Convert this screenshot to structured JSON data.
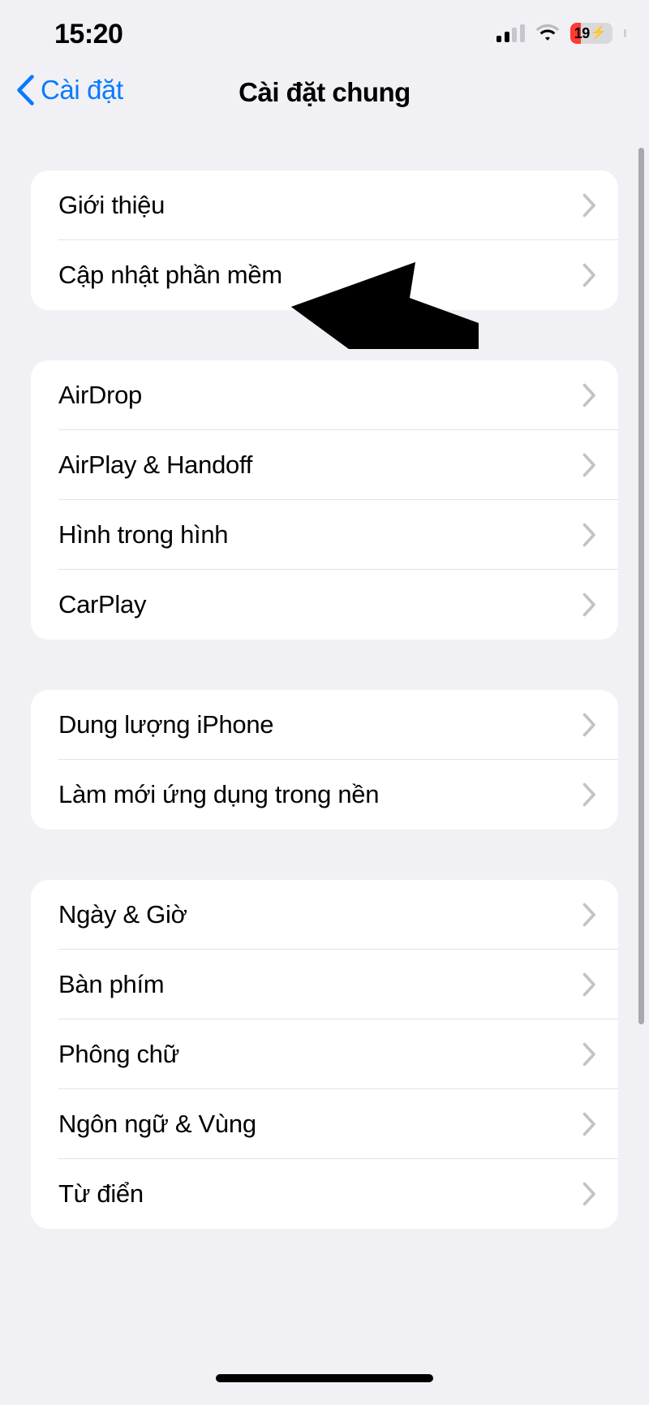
{
  "status_bar": {
    "time": "15:20",
    "cellular_bars_filled": 2,
    "cellular_bars_total": 4,
    "wifi_icon": "wifi-icon",
    "battery_percent": "19",
    "battery_charging": true,
    "battery_bolt": "⚡",
    "battery_color": "#ff3b30"
  },
  "nav": {
    "back_label": "Cài đặt",
    "back_icon": "chevron-left-icon",
    "title": "Cài đặt chung",
    "accent_color": "#0a7aff"
  },
  "groups": [
    {
      "id": "group-about",
      "rows": [
        {
          "label": "Giới thiệu",
          "accessory": "chevron-right-icon"
        },
        {
          "label": "Cập nhật phần mềm",
          "accessory": "chevron-right-icon"
        }
      ]
    },
    {
      "id": "group-connectivity",
      "rows": [
        {
          "label": "AirDrop",
          "accessory": "chevron-right-icon"
        },
        {
          "label": "AirPlay & Handoff",
          "accessory": "chevron-right-icon"
        },
        {
          "label": "Hình trong hình",
          "accessory": "chevron-right-icon"
        },
        {
          "label": "CarPlay",
          "accessory": "chevron-right-icon"
        }
      ]
    },
    {
      "id": "group-storage",
      "rows": [
        {
          "label": "Dung lượng iPhone",
          "accessory": "chevron-right-icon"
        },
        {
          "label": "Làm mới ứng dụng trong nền",
          "accessory": "chevron-right-icon"
        }
      ]
    },
    {
      "id": "group-system",
      "rows": [
        {
          "label": "Ngày & Giờ",
          "accessory": "chevron-right-icon"
        },
        {
          "label": "Bàn phím",
          "accessory": "chevron-right-icon"
        },
        {
          "label": "Phông chữ",
          "accessory": "chevron-right-icon"
        },
        {
          "label": "Ngôn ngữ & Vùng",
          "accessory": "chevron-right-icon"
        },
        {
          "label": "Từ điển",
          "accessory": "chevron-right-icon"
        }
      ]
    }
  ],
  "overlay": {
    "cursor_icon": "pointer-arrow-icon",
    "cursor_color": "#000000",
    "points_at": "Cập nhật phần mềm"
  },
  "scrollbar": {
    "orientation": "vertical",
    "color": "#a8a8ad"
  },
  "home_indicator": {
    "present": true
  }
}
